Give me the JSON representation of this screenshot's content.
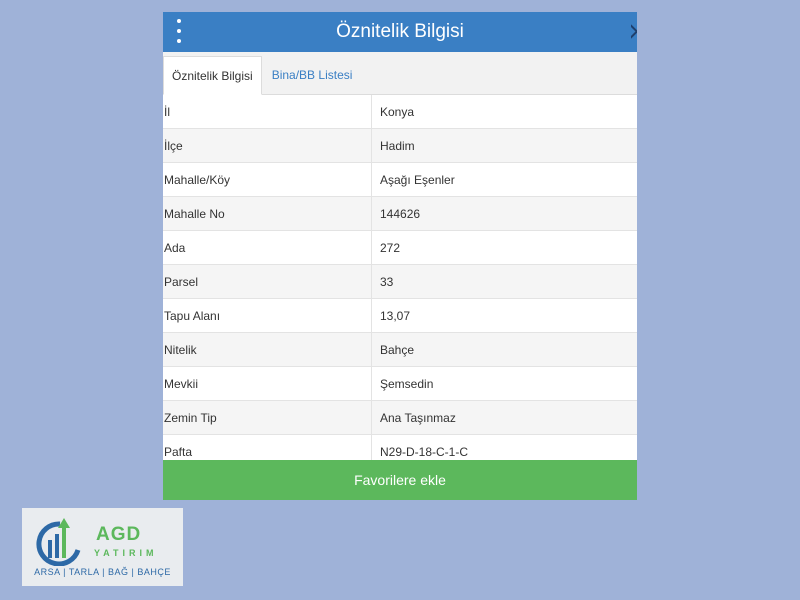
{
  "header": {
    "title": "Öznitelik Bilgisi"
  },
  "tabs": [
    {
      "label": "Öznitelik Bilgisi",
      "active": true
    },
    {
      "label": "Bina/BB Listesi",
      "active": false
    }
  ],
  "rows": [
    {
      "key": "İl",
      "value": "Konya"
    },
    {
      "key": "İlçe",
      "value": "Hadim"
    },
    {
      "key": "Mahalle/Köy",
      "value": "Aşağı Eşenler"
    },
    {
      "key": "Mahalle No",
      "value": "144626"
    },
    {
      "key": "Ada",
      "value": "272"
    },
    {
      "key": "Parsel",
      "value": "33"
    },
    {
      "key": "Tapu Alanı",
      "value": "13,07"
    },
    {
      "key": "Nitelik",
      "value": "Bahçe"
    },
    {
      "key": "Mevkii",
      "value": "Şemsedin"
    },
    {
      "key": "Zemin Tip",
      "value": "Ana Taşınmaz"
    },
    {
      "key": "Pafta",
      "value": "N29-D-18-C-1-C"
    }
  ],
  "footer": {
    "favorite_label": "Favorilere ekle"
  },
  "logo": {
    "name": "AGD",
    "sub": "YATIRIM",
    "tagline": "ARSA | TARLA | BAĞ | BAHÇE"
  },
  "colors": {
    "header": "#3a7fc4",
    "button": "#5cb85c",
    "background": "#9fb2d8"
  }
}
